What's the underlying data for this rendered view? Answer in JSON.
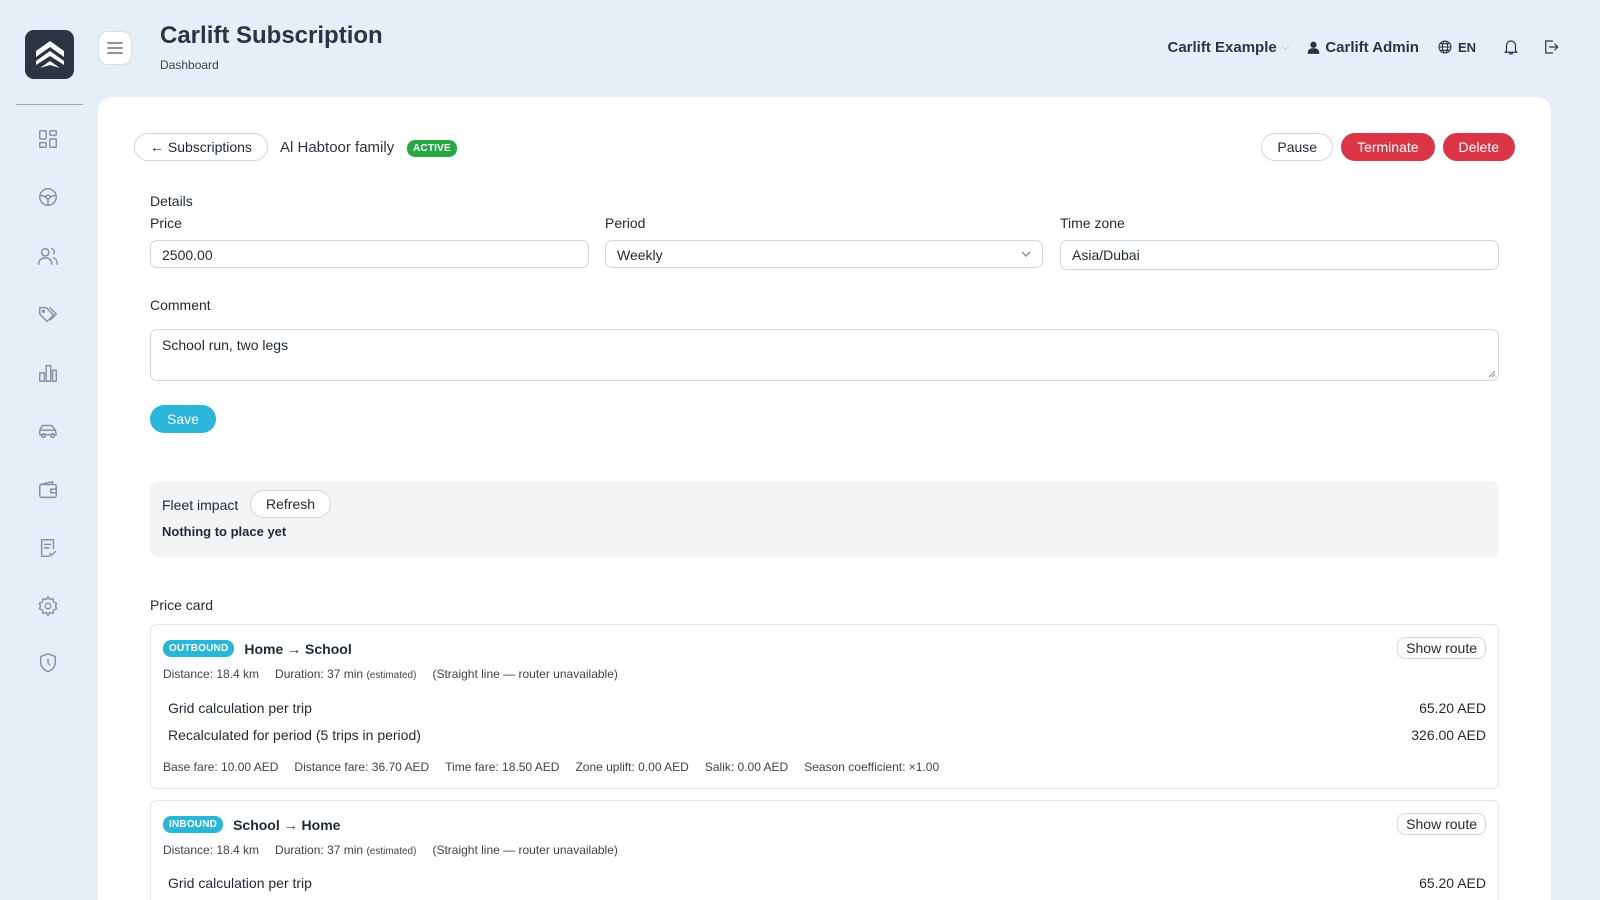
{
  "header": {
    "title": "Carlift Subscription",
    "breadcrumb": "Dashboard",
    "company": "Carlift Example",
    "user": "Carlift Admin",
    "language": "EN"
  },
  "subscription": {
    "back_label": "← Subscriptions",
    "name": "Al Habtoor family",
    "status": "ACTIVE",
    "actions": {
      "pause": "Pause",
      "terminate": "Terminate",
      "delete": "Delete"
    }
  },
  "details": {
    "section": "Details",
    "price_label": "Price",
    "price_value": "2500.00",
    "period_label": "Period",
    "period_value": "Weekly",
    "timezone_label": "Time zone",
    "timezone_value": "Asia/Dubai",
    "comment_label": "Comment",
    "comment_value": "School run, two legs",
    "save_label": "Save"
  },
  "fleet": {
    "label": "Fleet impact",
    "refresh_label": "Refresh",
    "status": "Nothing to place yet"
  },
  "price_card": {
    "section": "Price card",
    "routes": [
      {
        "direction": "OUTBOUND",
        "title": "Home → School",
        "show_route": "Show route",
        "distance": "Distance: 18.4 km",
        "duration": "Duration: 37 min",
        "estimated": "(estimated)",
        "note": "(Straight line — router unavailable)",
        "grid_label": "Grid calculation per trip",
        "grid_value": "65.20 AED",
        "period_label": "Recalculated for period (5 trips in period)",
        "period_value": "326.00 AED",
        "breakdown": [
          "Base fare: 10.00 AED",
          "Distance fare: 36.70 AED",
          "Time fare: 18.50 AED",
          "Zone uplift: 0.00 AED",
          "Salik: 0.00 AED",
          "Season coefficient: ×1.00"
        ]
      },
      {
        "direction": "INBOUND",
        "title": "School → Home",
        "show_route": "Show route",
        "distance": "Distance: 18.4 km",
        "duration": "Duration: 37 min",
        "estimated": "(estimated)",
        "note": "(Straight line — router unavailable)",
        "grid_label": "Grid calculation per trip",
        "grid_value": "65.20 AED"
      }
    ]
  },
  "colors": {
    "background": "#e6eef8",
    "accent": "#29b6d8",
    "danger": "#dc3545",
    "success": "#28a745",
    "dark": "#2b3440"
  },
  "icons": [
    "logo-icon",
    "dashboard-icon",
    "steering-wheel-icon",
    "users-icon",
    "tags-icon",
    "chart-icon",
    "car-icon",
    "wallet-icon",
    "checklist-icon",
    "gear-icon",
    "shield-icon",
    "menu-icon",
    "user-icon",
    "globe-icon",
    "bell-icon",
    "logout-icon"
  ]
}
